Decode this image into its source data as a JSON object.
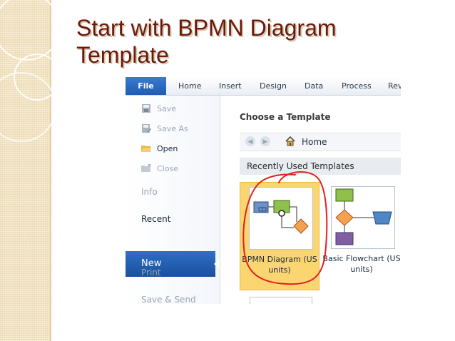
{
  "slide": {
    "title_line1": "Start with BPMN Diagram",
    "title_line2": "Template"
  },
  "ribbon": {
    "tabs": [
      {
        "label": "File",
        "active": true
      },
      {
        "label": "Home"
      },
      {
        "label": "Insert"
      },
      {
        "label": "Design"
      },
      {
        "label": "Data"
      },
      {
        "label": "Process"
      },
      {
        "label": "Rev"
      }
    ]
  },
  "backstage": {
    "commands": [
      {
        "label": "Save",
        "icon": "save-icon",
        "enabled": false
      },
      {
        "label": "Save As",
        "icon": "save-as-icon",
        "enabled": false
      },
      {
        "label": "Open",
        "icon": "open-folder-icon",
        "enabled": true
      },
      {
        "label": "Close",
        "icon": "close-folder-icon",
        "enabled": false
      }
    ],
    "categories": [
      {
        "label": "Info"
      },
      {
        "label": "Recent"
      },
      {
        "label": "New",
        "selected": true
      },
      {
        "label": "Print"
      },
      {
        "label": "Save & Send"
      }
    ]
  },
  "main": {
    "heading": "Choose a Template",
    "nav": {
      "location": "Home"
    },
    "section_header": "Recently Used Templates",
    "templates": [
      {
        "label": "BPMN Diagram (US units)",
        "selected": true
      },
      {
        "label": "Basic Flowchart (US units)",
        "selected": false
      }
    ]
  },
  "colors": {
    "title": "#6a1a0a",
    "file_tab": "#1f5bb3",
    "selected_category": "#2f6fc6",
    "selected_template": "#fbd570",
    "annotation_circle": "#e02020"
  }
}
